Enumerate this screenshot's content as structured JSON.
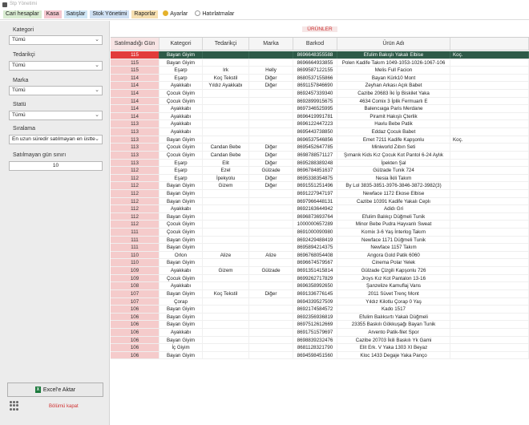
{
  "window": {
    "title": "Stp Yönetimi"
  },
  "menu": [
    {
      "label": "Cari hesaplar",
      "cls": "m-cari"
    },
    {
      "label": "Kasa",
      "cls": "m-kasa"
    },
    {
      "label": "Satışlar",
      "cls": "m-satis"
    },
    {
      "label": "Stok Yönetimi",
      "cls": "m-stok"
    },
    {
      "label": "Raporlar",
      "cls": "m-rapor"
    },
    {
      "label": "Ayarlar",
      "cls": "m-ayar"
    },
    {
      "label": "Hatırlatmalar",
      "cls": "m-hat"
    }
  ],
  "filters": {
    "kategori_label": "Kategori",
    "kategori_value": "Tümü",
    "tedarikci_label": "Tedarikçi",
    "tedarikci_value": "Tümü",
    "marka_label": "Marka",
    "marka_value": "Tümü",
    "statu_label": "Statü",
    "statu_value": "Tümü",
    "siralama_label": "Sıralama",
    "siralama_value": "En uzun süredir satılmayan en üstte",
    "limit_label": "Satılmayan gün sınırı",
    "limit_value": "10"
  },
  "excel_button": "Excel'e Aktar",
  "close_link": "Bölümü kapat",
  "section_title": "ÜRÜNLER",
  "columns": [
    "Satılmadığı Gün",
    "Kategori",
    "Tedarikçi",
    "Marka",
    "Barkod",
    "Ürün Adı",
    ""
  ],
  "rows": [
    [
      "115",
      "Bayan Giyim",
      "",
      "",
      "8696648355588",
      "Efulim Bakışlı Yakalı Elbise",
      "Koç."
    ],
    [
      "115",
      "Bayan Giyim",
      "",
      "",
      "8696664933855",
      "Polen Kadife Takım 1049-1053-1026-1067-106",
      ""
    ],
    [
      "115",
      "Eşarp",
      "Irk",
      "Helly",
      "8699587122155",
      "Melis Full Facion",
      ""
    ],
    [
      "114",
      "Eşarp",
      "Koç Tekstil",
      "Diğer",
      "8680537155866",
      "Bayan Kürk10 Mont",
      ""
    ],
    [
      "114",
      "Ayakkabı",
      "Yıldız Ayakkabı",
      "Diğer",
      "8691157846690",
      "Zeyhan Arkası Açık Babet",
      ""
    ],
    [
      "114",
      "Çocuk Giyim",
      "",
      "",
      "8692457339340",
      "Cazibe 20683 İki İp Biskilet Yaka",
      ""
    ],
    [
      "114",
      "Çocuk Giyim",
      "",
      "",
      "8692899915675",
      "4634 Comix 3 İplik Fermuarlı E",
      ""
    ],
    [
      "114",
      "Ayakkabı",
      "",
      "",
      "8697346525995",
      "Balencıaga Paris Merdane",
      ""
    ],
    [
      "114",
      "Ayakkabı",
      "",
      "",
      "8696419991781",
      "Piramit Hakışlı Çterlik",
      ""
    ],
    [
      "113",
      "Ayakkabı",
      "",
      "",
      "8696122447223",
      "Havlu Bebe Patik",
      ""
    ],
    [
      "113",
      "Ayakkabı",
      "",
      "",
      "8695443738850",
      "Eddaz Çocuk Babet",
      ""
    ],
    [
      "113",
      "Bayan Giyim",
      "",
      "",
      "8696537546856",
      "Emet 7211 Kadife Kapşonlu",
      "Koç."
    ],
    [
      "113",
      "Çocuk Giyim",
      "Candan Bebe",
      "Diğer",
      "8695452647785",
      "Miniworld Zıbın Seti",
      ""
    ],
    [
      "113",
      "Çocuk Giyim",
      "Candan Bebe",
      "Diğer",
      "8698788571127",
      "Şımarık Kids Kız Çocuk Kot Pantol 6-24 Aylık",
      ""
    ],
    [
      "113",
      "Eşarp",
      "Elit",
      "Diğer",
      "8695288389248",
      "İpekten Şal",
      ""
    ],
    [
      "112",
      "Eşarp",
      "Ezel",
      "Gülzade",
      "8696784851637",
      "Gülzade Tunik 724",
      ""
    ],
    [
      "112",
      "Eşarp",
      "İpekyolu",
      "Diğer",
      "8695338354875",
      "Nesia İkili Takım",
      ""
    ],
    [
      "112",
      "Bayan Giyim",
      "Gizem",
      "Diğer",
      "8691551251496",
      "By Lol 3835-3851-3976-3846-3872-3982(3)",
      ""
    ],
    [
      "112",
      "Bayan Giyim",
      "",
      "",
      "8691227947197",
      "Newface 1172 Ekose Elbise",
      ""
    ],
    [
      "112",
      "Bayan Giyim",
      "",
      "",
      "8697966448131",
      "Cazibe 10391 Kadife Yakalı Ceplı",
      ""
    ],
    [
      "112",
      "Ayakkabı",
      "",
      "",
      "8692163644942",
      "Adidı Gri",
      ""
    ],
    [
      "112",
      "Bayan Giyim",
      "",
      "",
      "8696873693764",
      "Efulim Balıkçı Düğmeli Tunik",
      ""
    ],
    [
      "112",
      "Çocuk Giyim",
      "",
      "",
      "1000000657289",
      "Minor Bebe Pudra Hayvanlı Sweat",
      ""
    ],
    [
      "111",
      "Çocuk Giyim",
      "",
      "",
      "8691000090980",
      "Komix 3-6 Yaş İnterlog Takım",
      ""
    ],
    [
      "111",
      "Bayan Giyim",
      "",
      "",
      "8692429488419",
      "Newface 1171 Düğmeli Tunik",
      ""
    ],
    [
      "111",
      "Bayan Giyim",
      "",
      "",
      "8695894214375",
      "Newface 1157 Takım",
      ""
    ],
    [
      "110",
      "Orlon",
      "Alize",
      "Alize",
      "8696768054408",
      "Angora Gold Patik 6060",
      ""
    ],
    [
      "110",
      "Bayan Giyim",
      "",
      "",
      "8696674579567",
      "Cinema Polar Yelek",
      ""
    ],
    [
      "109",
      "Ayakkabı",
      "Gizem",
      "Gülzade",
      "8691351415814",
      "Gülzade Çizgili Kapşonlu 726",
      ""
    ],
    [
      "109",
      "Çocuk Giyim",
      "",
      "",
      "8699262717829",
      "Jroys Kız Kot Pantalon 13-16",
      ""
    ],
    [
      "108",
      "Ayakkabı",
      "",
      "",
      "8696358992650",
      "Şanzelize Kamuflaj Vans",
      ""
    ],
    [
      "107",
      "Bayan Giyim",
      "Koç Tekstil",
      "Diğer",
      "8691336776145",
      "2011 Süvet Trenç Mont",
      ""
    ],
    [
      "107",
      "Çorap",
      "",
      "",
      "8694339527509",
      "Yıldız Kilotlu Çorap 0 Yaş",
      ""
    ],
    [
      "106",
      "Bayan Giyim",
      "",
      "",
      "8692174584572",
      "Kado 1517",
      ""
    ],
    [
      "106",
      "Bayan Giyim",
      "",
      "",
      "8692356936819",
      "Efulim Balıksırtı Yakalı Düğmeli",
      ""
    ],
    [
      "106",
      "Bayan Giyim",
      "",
      "",
      "8697512612669",
      "23355 Baskılı Gökkuşağı Bayan Tunik",
      ""
    ],
    [
      "106",
      "Ayakkabı",
      "",
      "",
      "8691751579697",
      "Arvento Patik-filet Spor",
      ""
    ],
    [
      "106",
      "Bayan Giyim",
      "",
      "",
      "8698839232476",
      "Cazibe 20703 İkili Baskılı Yk Gami",
      ""
    ],
    [
      "106",
      "İç Giyim",
      "",
      "",
      "8681128321790",
      "Elit Erk. V Yaka 1303 XI Beyaz",
      ""
    ],
    [
      "106",
      "Bayan Giyim",
      "",
      "",
      "8694598451560",
      "Kloc 1433 Degaje Yaka Panço",
      ""
    ]
  ]
}
